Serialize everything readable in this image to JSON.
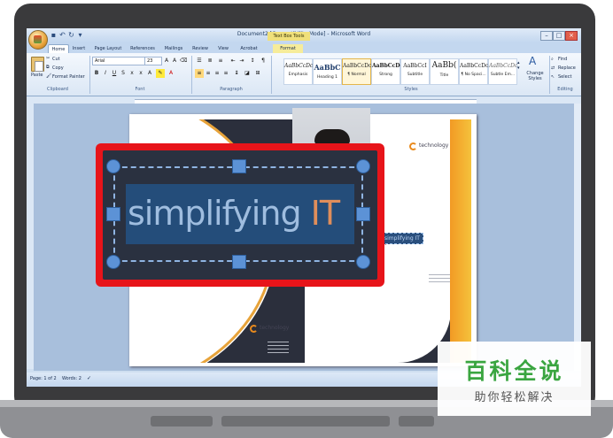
{
  "window": {
    "title": "Document2 [Compatibility Mode] - Microsoft Word",
    "context_tab_label": "Text Box Tools"
  },
  "tabs": [
    "Home",
    "Insert",
    "Page Layout",
    "References",
    "Mailings",
    "Review",
    "View",
    "Acrobat",
    "Format"
  ],
  "ribbon": {
    "clipboard": {
      "label": "Clipboard",
      "paste": "Paste",
      "cut": "Cut",
      "copy": "Copy",
      "format_painter": "Format Painter"
    },
    "font": {
      "label": "Font",
      "name": "Arial",
      "size": "23"
    },
    "paragraph": {
      "label": "Paragraph"
    },
    "styles": {
      "label": "Styles",
      "items": [
        {
          "sample": "AaBbCcDc",
          "name": "Emphasis"
        },
        {
          "sample": "AaBbC",
          "name": "Heading 1"
        },
        {
          "sample": "AaBbCcDc",
          "name": "¶ Normal"
        },
        {
          "sample": "AaBbCcDd",
          "name": "Strong"
        },
        {
          "sample": "AaBbCcI",
          "name": "Subtitle"
        },
        {
          "sample": "AaBb(",
          "name": "Title"
        },
        {
          "sample": "AaBbCcDc",
          "name": "¶ No Spaci..."
        },
        {
          "sample": "AaBbCcDc",
          "name": "Subtle Em..."
        }
      ],
      "change_styles": "Change Styles"
    },
    "editing": {
      "label": "Editing",
      "find": "Find",
      "replace": "Replace",
      "select": "Select"
    }
  },
  "document": {
    "logo_text": "technology",
    "small_textbox": "simplifying IT"
  },
  "zoom": {
    "text_main": "simplifying ",
    "text_it": "IT"
  },
  "status": {
    "page": "Page: 1 of 2",
    "words": "Words: 2"
  },
  "watermark": {
    "title": "百科全说",
    "subtitle": "助你轻松解决"
  }
}
